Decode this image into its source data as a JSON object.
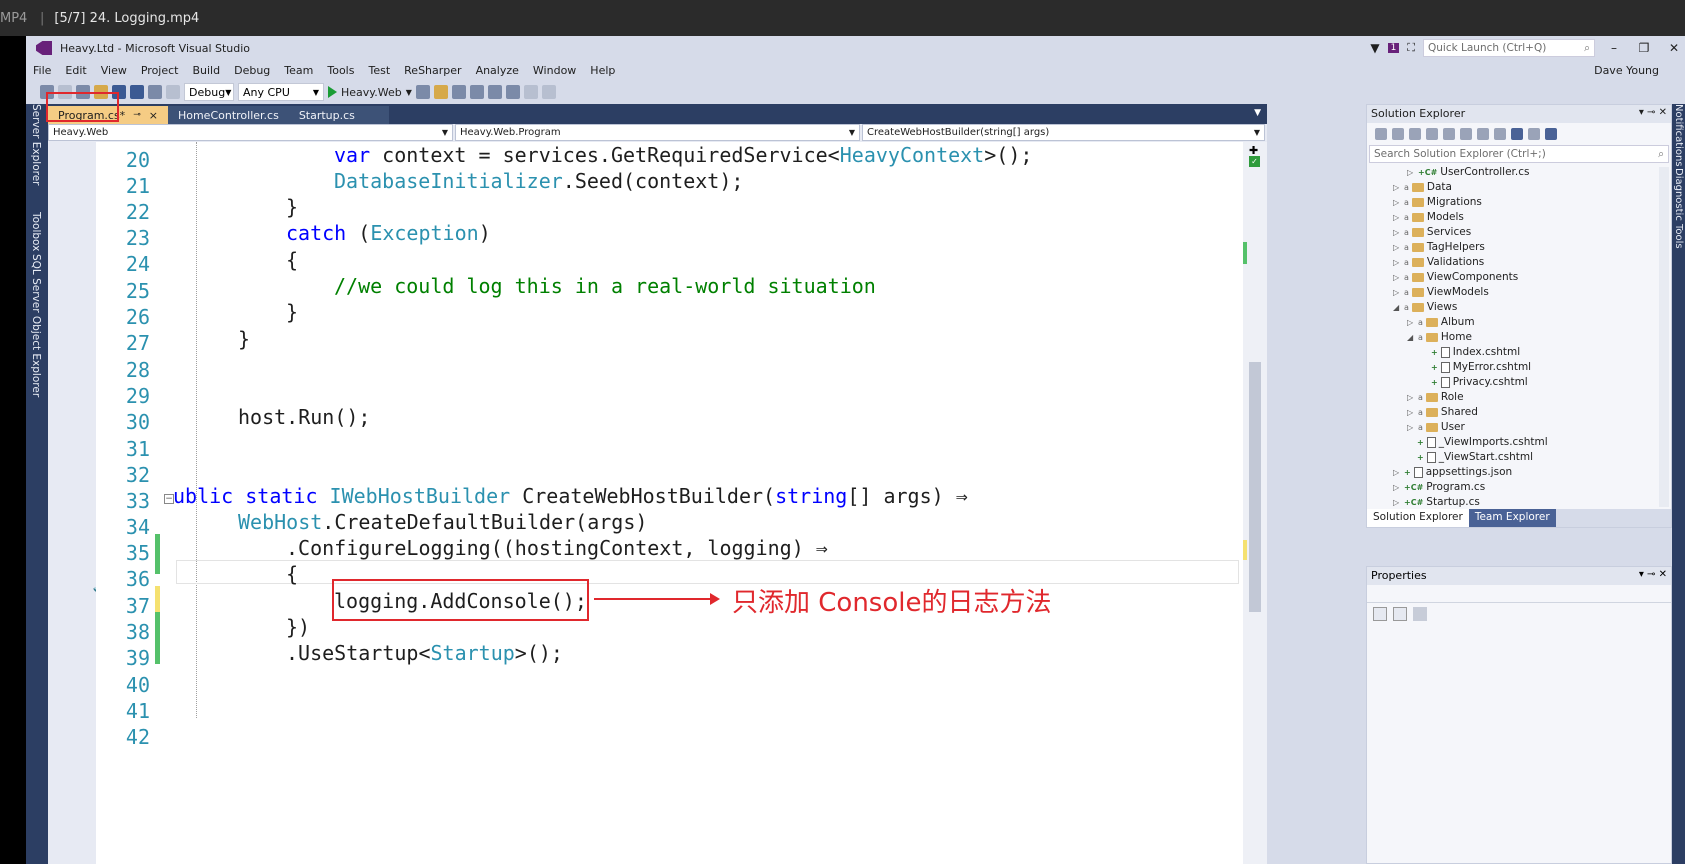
{
  "player": {
    "format": "MP4",
    "title": "[5/7] 24. Logging.mp4"
  },
  "window": {
    "title": "Heavy.Ltd - Microsoft Visual Studio",
    "quick_launch": "Quick Launch (Ctrl+Q)",
    "user": "Dave Young",
    "notif_count": "1"
  },
  "menu": [
    "File",
    "Edit",
    "View",
    "Project",
    "Build",
    "Debug",
    "Team",
    "Tools",
    "Test",
    "ReSharper",
    "Analyze",
    "Window",
    "Help"
  ],
  "toolbar": {
    "config": "Debug",
    "platform": "Any CPU",
    "run_target": "Heavy.Web"
  },
  "left_strip": [
    "Server Explorer",
    "Toolbox",
    "SQL Server Object Explorer"
  ],
  "right_strip": [
    "Notifications",
    "Diagnostic Tools"
  ],
  "tabs": [
    {
      "label": "Program.cs*",
      "close": "×"
    },
    {
      "label": "HomeController.cs"
    },
    {
      "label": "Startup.cs"
    }
  ],
  "navbar": {
    "project": "Heavy.Web",
    "type": "Heavy.Web.Program",
    "member": "CreateWebHostBuilder(string[] args)"
  },
  "lines": [
    "20",
    "21",
    "22",
    "23",
    "24",
    "25",
    "26",
    "27",
    "28",
    "29",
    "30",
    "31",
    "32",
    "33",
    "34",
    "35",
    "36",
    "37",
    "38",
    "39",
    "40",
    "41",
    "42"
  ],
  "code": {
    "l20a": "var",
    "l20b": " context = services.GetRequiredService<",
    "l20c": "HeavyContext",
    "l20d": ">();",
    "l21a": "DatabaseInitializer",
    "l21b": ".Seed(context);",
    "l22": "}",
    "l23a": "catch",
    "l23b": " (",
    "l23c": "Exception",
    "l23d": ")",
    "l24": "{",
    "l25": "//we could log this in a real-world situation",
    "l26": "}",
    "l27": "}",
    "l30": "host.Run();",
    "l33a": "ublic",
    "l33b": " static ",
    "l33c": "IWebHostBuilder",
    "l33d": " CreateWebHostBuilder(",
    "l33e": "string",
    "l33f": "[] args) ⇒",
    "l34a": "WebHost",
    "l34b": ".CreateDefaultBuilder(args)",
    "l35": ".ConfigureLogging((hostingContext, logging) ⇒",
    "l36": "{",
    "l37": "logging.AddConsole();",
    "l38": "})",
    "l39a": ".UseStartup<",
    "l39b": "Startup",
    "l39c": ">();"
  },
  "annotation": {
    "text": "只添加 Console的日志方法"
  },
  "solution_explorer": {
    "title": "Solution Explorer",
    "search": "Search Solution Explorer (Ctrl+;)",
    "items": [
      {
        "label": "UserController.cs",
        "kind": "cs"
      },
      {
        "label": "Data",
        "kind": "folder"
      },
      {
        "label": "Migrations",
        "kind": "folder"
      },
      {
        "label": "Models",
        "kind": "folder"
      },
      {
        "label": "Services",
        "kind": "folder"
      },
      {
        "label": "TagHelpers",
        "kind": "folder"
      },
      {
        "label": "Validations",
        "kind": "folder"
      },
      {
        "label": "ViewComponents",
        "kind": "folder"
      },
      {
        "label": "ViewModels",
        "kind": "folder"
      },
      {
        "label": "Views",
        "kind": "folder"
      },
      {
        "label": "Album",
        "kind": "folder"
      },
      {
        "label": "Home",
        "kind": "folder"
      },
      {
        "label": "Index.cshtml",
        "kind": "file"
      },
      {
        "label": "MyError.cshtml",
        "kind": "file"
      },
      {
        "label": "Privacy.cshtml",
        "kind": "file"
      },
      {
        "label": "Role",
        "kind": "folder"
      },
      {
        "label": "Shared",
        "kind": "folder"
      },
      {
        "label": "User",
        "kind": "folder"
      },
      {
        "label": "_ViewImports.cshtml",
        "kind": "file"
      },
      {
        "label": "_ViewStart.cshtml",
        "kind": "file"
      },
      {
        "label": "appsettings.json",
        "kind": "file"
      },
      {
        "label": "Program.cs",
        "kind": "cs"
      },
      {
        "label": "Startup.cs",
        "kind": "cs"
      }
    ],
    "tab_active": "Solution Explorer",
    "tab_other": "Team Explorer"
  },
  "properties": {
    "title": "Properties"
  },
  "colors": {
    "accent_red": "#e0282d",
    "keyword": "#0000ff",
    "type": "#2b91af",
    "comment": "#008000"
  }
}
